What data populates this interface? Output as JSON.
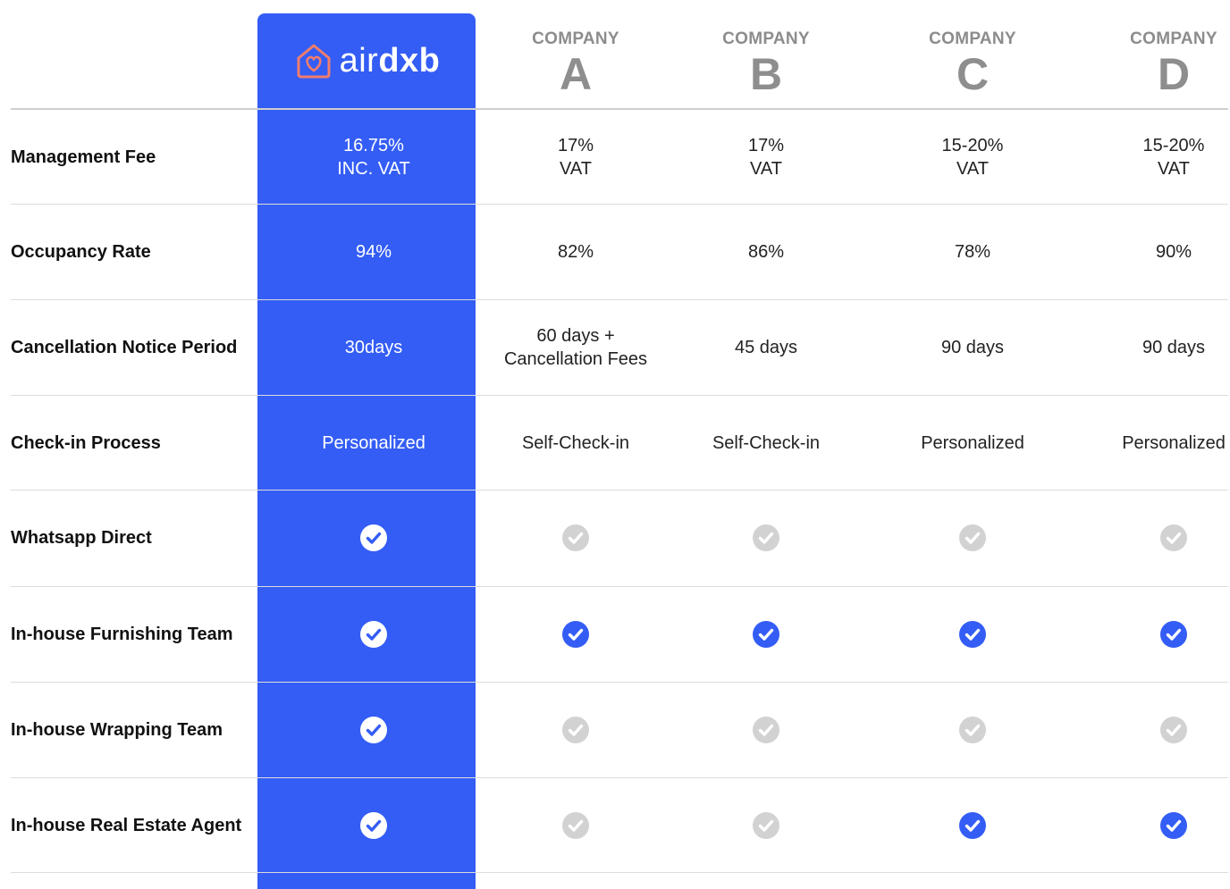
{
  "brand": {
    "logo_air": "air",
    "logo_dxb": "dxb",
    "colors": {
      "highlight": "#345df5",
      "check_blue": "#345df5",
      "check_grey": "#d2d2d2",
      "logo_icon": "#f07d6e"
    }
  },
  "companies": [
    {
      "word": "COMPANY",
      "letter": "A"
    },
    {
      "word": "COMPANY",
      "letter": "B"
    },
    {
      "word": "COMPANY",
      "letter": "C"
    },
    {
      "word": "COMPANY",
      "letter": "D"
    }
  ],
  "rows": [
    {
      "label": "Management Fee",
      "values": [
        [
          "16.75%",
          "INC. VAT"
        ],
        [
          "17%",
          "VAT"
        ],
        [
          "17%",
          "VAT"
        ],
        [
          "15-20%",
          "VAT"
        ],
        [
          "15-20%",
          "VAT"
        ]
      ]
    },
    {
      "label": "Occupancy Rate",
      "values": [
        [
          "94%"
        ],
        [
          "82%"
        ],
        [
          "86%"
        ],
        [
          "78%"
        ],
        [
          "90%"
        ]
      ]
    },
    {
      "label": "Cancellation Notice Period",
      "values": [
        [
          "30days"
        ],
        [
          "60 days +",
          "Cancellation Fees"
        ],
        [
          "45 days"
        ],
        [
          "90 days"
        ],
        [
          "90 days"
        ]
      ]
    },
    {
      "label": "Check-in Process",
      "values": [
        [
          "Personalized"
        ],
        [
          "Self-Check-in"
        ],
        [
          "Self-Check-in"
        ],
        [
          "Personalized"
        ],
        [
          "Personalized"
        ]
      ]
    },
    {
      "label": "Whatsapp Direct",
      "checks": [
        true,
        false,
        false,
        false,
        false
      ]
    },
    {
      "label": "In-house Furnishing Team",
      "checks": [
        true,
        true,
        true,
        true,
        true
      ]
    },
    {
      "label": "In-house Wrapping Team",
      "checks": [
        true,
        false,
        false,
        false,
        false
      ]
    },
    {
      "label": "In-house Real Estate Agent",
      "checks": [
        true,
        false,
        false,
        true,
        true
      ]
    }
  ]
}
